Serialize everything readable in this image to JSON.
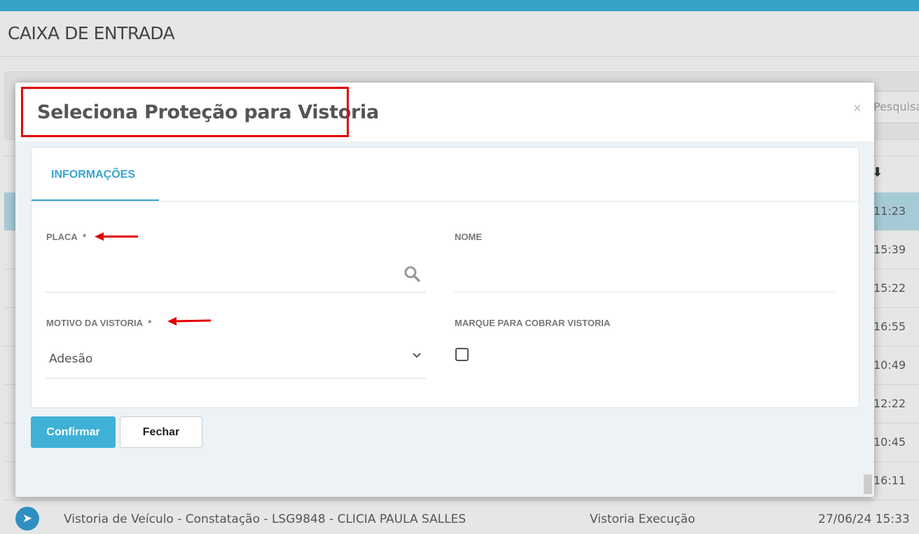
{
  "page": {
    "title": "CAIXA DE ENTRADA"
  },
  "background": {
    "search_placeholder": "Pesquisa",
    "sort_icon": "arrow-down-icon",
    "times": [
      "11:23",
      "15:39",
      "15:22",
      "16:55",
      "10:49",
      "12:22",
      "10:45",
      "16:11"
    ],
    "last_row": {
      "description": "Vistoria de Veículo - Constatação - LSG9848 - CLICIA PAULA SALLES",
      "status": "Vistoria Execução",
      "datetime": "27/06/24 15:33"
    }
  },
  "modal": {
    "title": "Seleciona Proteção para Vistoria",
    "close_label": "×",
    "tab": "INFORMAÇÕES",
    "fields": {
      "placa": {
        "label": "PLACA",
        "required_mark": "*",
        "value": ""
      },
      "nome": {
        "label": "NOME",
        "value": ""
      },
      "motivo": {
        "label": "MOTIVO DA VISTORIA",
        "required_mark": "*",
        "value": "Adesão"
      },
      "cobrar": {
        "label": "MARQUE PARA COBRAR VISTORIA",
        "checked": false
      }
    },
    "buttons": {
      "confirm": "Confirmar",
      "close": "Fechar"
    }
  },
  "colors": {
    "accent": "#3aa4cf",
    "topbar": "#35a3c6",
    "annotation": "#e00000"
  }
}
